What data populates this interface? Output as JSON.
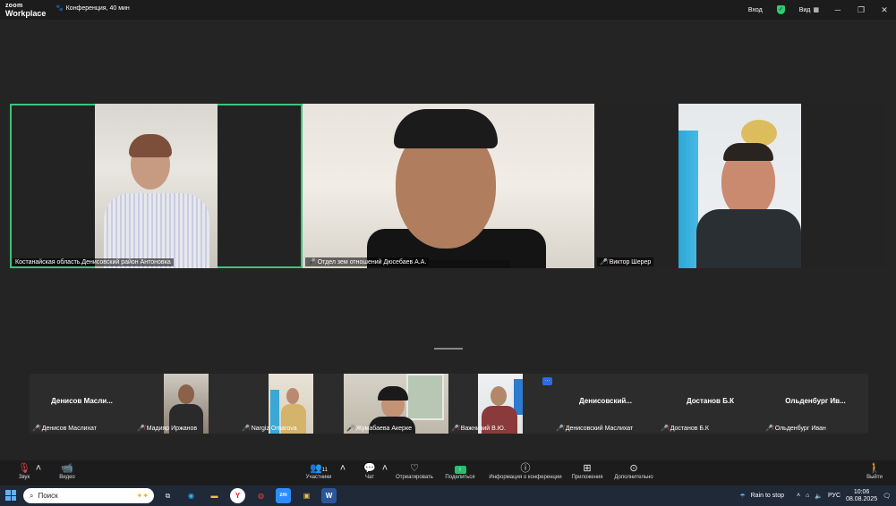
{
  "app": {
    "logo_line1": "zoom",
    "logo_line2": "Workplace",
    "conference_title": "Конференция, 40 мин"
  },
  "titlebar": {
    "login_label": "Вход",
    "view_label": "Вид"
  },
  "speakers": [
    {
      "name": "Костанайская область.Денисовский район Антоновка",
      "muted": false,
      "active": true
    },
    {
      "name": "Отдел зем отношений Дюсебаев А.А.",
      "muted": true,
      "active": false
    },
    {
      "name": "Виктор Шерер",
      "muted": true,
      "active": false
    }
  ],
  "thumbnails": [
    {
      "name": "Денисов Маслихат",
      "big_name": "Денисов  Масли...",
      "muted": true,
      "has_video": false
    },
    {
      "name": "Мадияр Иржанов",
      "big_name": "",
      "muted": true,
      "has_video": true
    },
    {
      "name": "Nargiz Omarova",
      "big_name": "",
      "muted": true,
      "has_video": true
    },
    {
      "name": "Жумабаева Акерке",
      "big_name": "",
      "muted": true,
      "has_video": true
    },
    {
      "name": "Важничий В.Ю.",
      "big_name": "",
      "muted": true,
      "has_video": true
    },
    {
      "name": "Денисовский Маслихат",
      "big_name": "Денисовский...",
      "muted": true,
      "has_video": false
    },
    {
      "name": "Достанов Б.К",
      "big_name": "Достанов Б.К",
      "muted": true,
      "has_video": false
    },
    {
      "name": "Ольденбург Иван",
      "big_name": "Ольденбург  Ив...",
      "muted": true,
      "has_video": false
    }
  ],
  "toolbar": {
    "audio": "Звук",
    "video": "Видео",
    "participants": "Участники",
    "participants_count": "11",
    "chat": "Чат",
    "react": "Отреагировать",
    "share": "Поделиться",
    "info": "Информация о конференции",
    "apps": "Приложения",
    "more": "Дополнительно",
    "leave": "Выйти"
  },
  "taskbar": {
    "search_placeholder": "Поиск",
    "weather": "Rain to stop",
    "lang": "РУС",
    "time": "10:06",
    "date": "08.08.2025"
  },
  "colors": {
    "active_border": "#3ec27a",
    "mute": "#e54848",
    "share": "#23c16b"
  }
}
